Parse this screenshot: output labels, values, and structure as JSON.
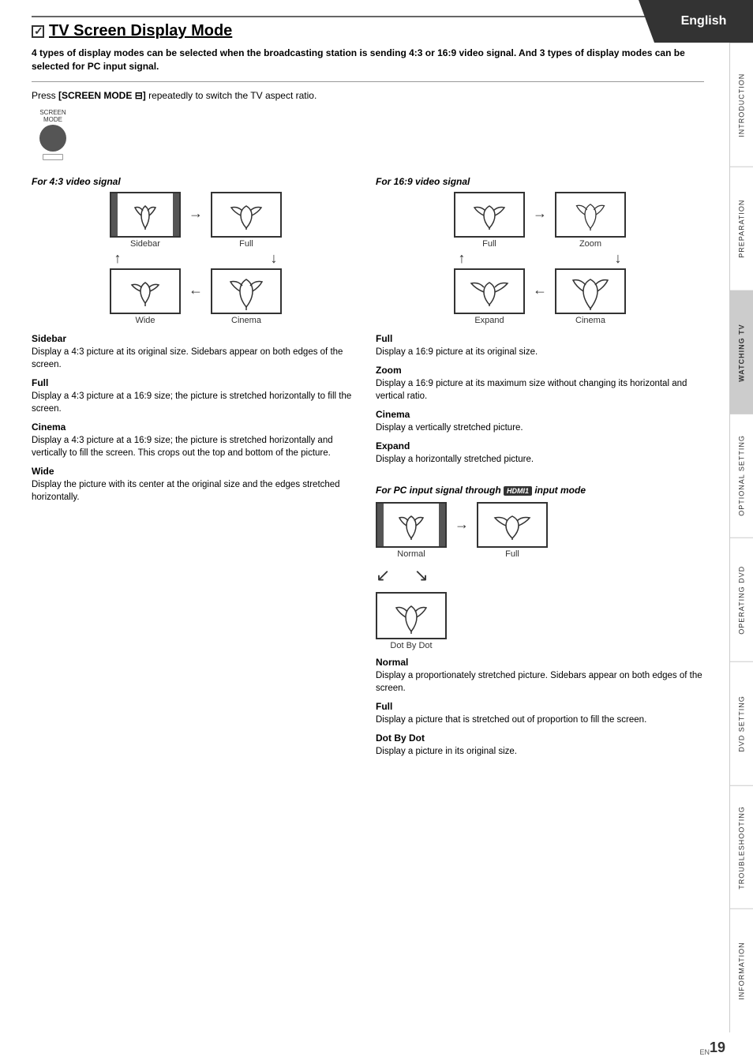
{
  "english_label": "English",
  "page_number": "19",
  "page_en_label": "EN",
  "sidebar_sections": [
    "INTRODUCTION",
    "PREPARATION",
    "WATCHING TV",
    "OPTIONAL SETTING",
    "OPERATING DVD",
    "DVD SETTING",
    "TROUBLESHOOTING",
    "INFORMATION"
  ],
  "title": "TV Screen Display Mode",
  "subtitle": "4 types of display modes can be selected when the broadcasting station is sending 4:3 or 16:9 video signal. And 3 types of display modes can be selected for PC input signal.",
  "press_text_before": "Press ",
  "press_bold": "[SCREEN MODE",
  "press_text_after": "] repeatedly to switch the TV aspect ratio.",
  "screen_mode_label": "SCREEN\nMODE",
  "section_43": {
    "title": "For 4:3 video signal",
    "labels": {
      "sidebar": "Sidebar",
      "full": "Full",
      "wide": "Wide",
      "cinema": "Cinema"
    },
    "sidebar_heading": "Sidebar",
    "sidebar_desc": "Display a 4:3 picture at its original size. Sidebars appear on both edges of the screen.",
    "full_heading": "Full",
    "full_desc": "Display a 4:3 picture at a 16:9 size; the picture is stretched horizontally to fill the screen.",
    "cinema_heading": "Cinema",
    "cinema_desc": "Display a 4:3 picture at a 16:9 size; the picture is stretched horizontally and vertically to fill the screen. This crops out the top and bottom of the picture.",
    "wide_heading": "Wide",
    "wide_desc": "Display the picture with its center at the original size and the edges stretched horizontally."
  },
  "section_169": {
    "title": "For 16:9 video signal",
    "labels": {
      "full": "Full",
      "zoom": "Zoom",
      "expand": "Expand",
      "cinema": "Cinema"
    },
    "full_heading": "Full",
    "full_desc": "Display a 16:9 picture at its original size.",
    "zoom_heading": "Zoom",
    "zoom_desc": "Display a 16:9 picture at its maximum size without changing its horizontal and vertical ratio.",
    "cinema_heading": "Cinema",
    "cinema_desc": "Display a vertically stretched picture.",
    "expand_heading": "Expand",
    "expand_desc": "Display a horizontally stretched picture."
  },
  "section_pc": {
    "title_before": "For PC input signal through ",
    "hdmi_label": "HDMI1",
    "title_after": " input mode",
    "labels": {
      "normal": "Normal",
      "full": "Full",
      "dot_by_dot": "Dot By Dot"
    },
    "normal_heading": "Normal",
    "normal_desc": "Display a proportionately stretched picture. Sidebars appear on both edges of the screen.",
    "full_heading": "Full",
    "full_desc": "Display a picture that is stretched out of proportion to fill the screen.",
    "dot_heading": "Dot By Dot",
    "dot_desc": "Display a picture in its original size."
  }
}
